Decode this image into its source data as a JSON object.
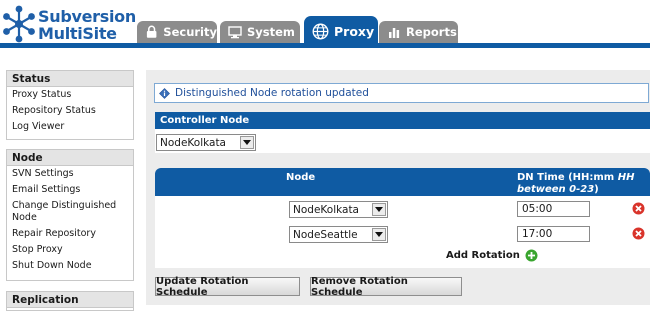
{
  "app": {
    "logo_line1": "Subversion",
    "logo_line2": "MultiSite"
  },
  "tabs": [
    {
      "label": "Security",
      "icon": "lock-icon",
      "active": false
    },
    {
      "label": "System",
      "icon": "monitor-icon",
      "active": false
    },
    {
      "label": "Proxy",
      "icon": "globe-icon",
      "active": true
    },
    {
      "label": "Reports",
      "icon": "bar-chart-icon",
      "active": false
    }
  ],
  "sidebar": {
    "status": {
      "title": "Status",
      "items": [
        "Proxy Status",
        "Repository Status",
        "Log Viewer"
      ]
    },
    "node": {
      "title": "Node",
      "items": [
        "SVN Settings",
        "Email Settings",
        "Change Distinguished Node",
        "Repair Repository",
        "Stop Proxy",
        "Shut Down Node"
      ]
    },
    "replication": {
      "title": "Replication"
    }
  },
  "message": "Distinguished Node rotation updated",
  "controller": {
    "title": "Controller Node",
    "selected": "NodeKolkata"
  },
  "rotation": {
    "col_node": "Node",
    "col_time": "DN Time (HH:mm",
    "col_time_italic": "HH between 0-23",
    "col_time_end": ")",
    "rows": [
      {
        "node": "NodeKolkata",
        "time": "05:00"
      },
      {
        "node": "NodeSeattle",
        "time": "17:00"
      }
    ],
    "add_label": "Add Rotation"
  },
  "buttons": {
    "update": "Update Rotation Schedule",
    "remove": "Remove Rotation Schedule"
  },
  "colors": {
    "brand_blue": "#0f5ba3",
    "tab_gray": "#8c8c8c",
    "remove_red": "#d9342b",
    "add_green": "#3aa52f"
  }
}
